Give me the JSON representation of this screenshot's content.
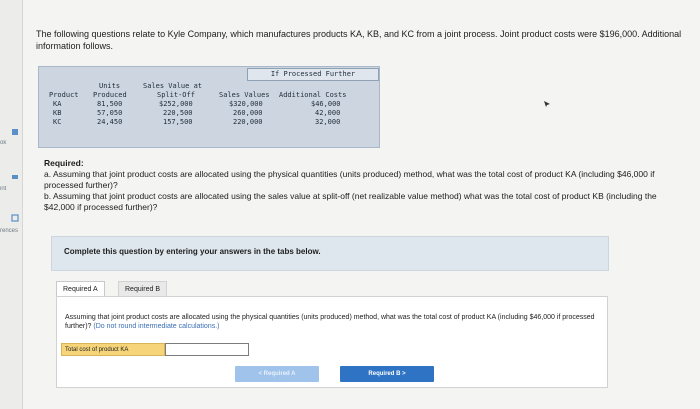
{
  "sidebar": {
    "items": [
      "ok",
      "int",
      "rences"
    ]
  },
  "intro": {
    "text": "The following questions relate to Kyle Company, which manufactures products KA, KB, and KC from a joint process. Joint product costs were $196,000. Additional information follows."
  },
  "table": {
    "group_header": "If Processed Further",
    "headers": {
      "product": "Product",
      "units_top": "Units",
      "units_bottom": "Produced",
      "sales_top": "Sales Value at",
      "sales_bottom": "Split-Off",
      "sales_values": "Sales Values",
      "additional_costs": "Additional Costs"
    },
    "rows": [
      {
        "product": "KA",
        "units": "81,500",
        "split_off": "$252,000",
        "sales_values": "$320,000",
        "additional_costs": "$46,000"
      },
      {
        "product": "KB",
        "units": "57,050",
        "split_off": "220,500",
        "sales_values": "260,000",
        "additional_costs": "42,000"
      },
      {
        "product": "KC",
        "units": "24,450",
        "split_off": "157,500",
        "sales_values": "220,000",
        "additional_costs": "32,000"
      }
    ]
  },
  "required": {
    "title": "Required:",
    "a": "a. Assuming that joint product costs are allocated using the physical quantities (units produced) method, what was the total cost of product KA (including $46,000 if processed further)?",
    "b": "b. Assuming that joint product costs are allocated using the sales value at split-off (net realizable value method) what was the total cost of product KB (including the $42,000 if processed further)?"
  },
  "banner": {
    "text": "Complete this question by entering your answers in the tabs below."
  },
  "tabs": [
    {
      "label": "Required A"
    },
    {
      "label": "Required B"
    }
  ],
  "panel": {
    "question": "Assuming that joint product costs are allocated using the physical quantities (units produced) method, what was the total cost of product KA (including $46,000 if processed further)?",
    "note": "(Do not round intermediate calculations.)",
    "answer_label": "Total cost of product KA",
    "answer_value": ""
  },
  "nav": {
    "prev_label": "< Required A",
    "next_label": "Required B >"
  },
  "colors": {
    "accent": "#2f74c4",
    "banner": "#dfe7ee",
    "answer_label_bg": "#f6d57a"
  }
}
